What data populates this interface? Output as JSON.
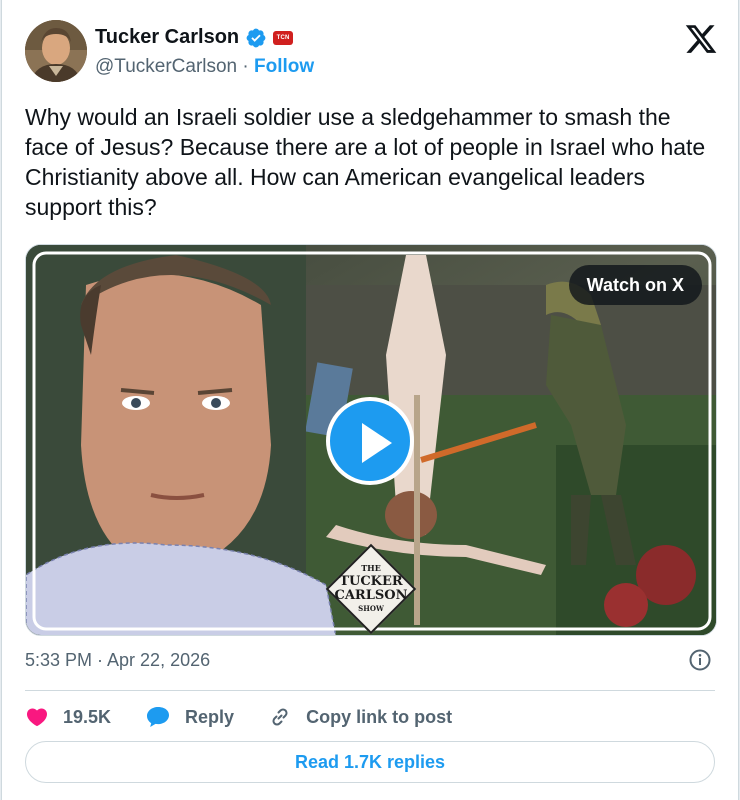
{
  "author": {
    "name": "Tucker Carlson",
    "handle": "@TuckerCarlson",
    "separator": " · ",
    "follow_label": "Follow",
    "affiliate_badge": "TCN"
  },
  "tweet": {
    "text": "Why would an Israeli soldier use a sledgehammer to smash the face of Jesus? Because there are a lot of people in Israel who hate Christianity above all. How can American evangelical leaders support this?"
  },
  "media": {
    "watch_label": "Watch on X",
    "show_logo": {
      "line1": "THE",
      "line2": "TUCKER",
      "line3": "CARLSON",
      "line4": "SHOW"
    }
  },
  "timestamp": "5:33 PM · Apr 22, 2026",
  "actions": {
    "likes": "19.5K",
    "reply_label": "Reply",
    "copy_label": "Copy link to post"
  },
  "read_replies_label": "Read 1.7K replies",
  "colors": {
    "accent": "#1d9bf0",
    "like": "#f91880",
    "text": "#0f1419",
    "muted": "#536471"
  },
  "icons": [
    "verified-badge-icon",
    "x-logo-icon",
    "play-icon",
    "info-icon",
    "heart-icon",
    "reply-icon",
    "link-icon"
  ]
}
